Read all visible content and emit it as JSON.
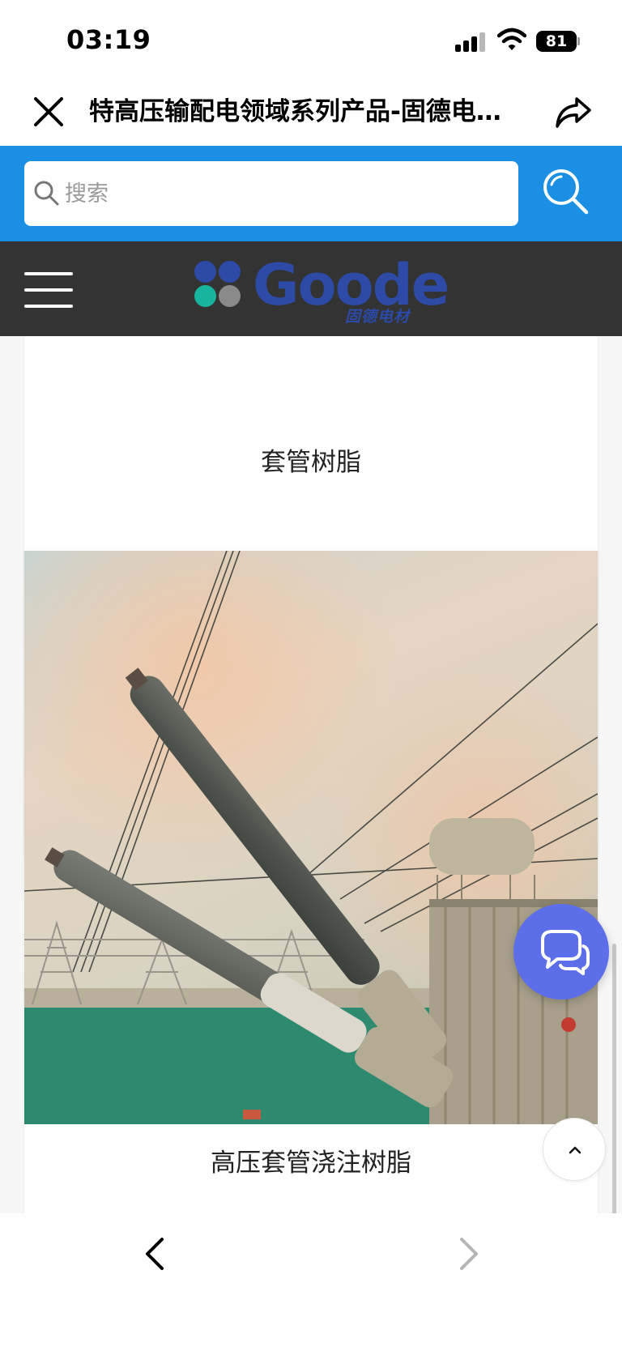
{
  "status_bar": {
    "time": "03:19",
    "battery_level": "81",
    "icons": [
      "signal-icon",
      "wifi-icon",
      "battery-icon"
    ]
  },
  "title_bar": {
    "title": "特高压输配电领域系列产品-固德电…",
    "icons": [
      "close-icon",
      "share-icon"
    ]
  },
  "search": {
    "placeholder": "搜索",
    "value": "",
    "accent_color": "#1a8fe3"
  },
  "header": {
    "logo_text": "Goode",
    "logo_subtitle": "固德电材",
    "background_color": "#333333",
    "brand_color": "#2c4aa6",
    "icons": [
      "menu-icon"
    ]
  },
  "products": [
    {
      "caption": "套管树脂"
    },
    {
      "caption": "高压套管浇注树脂"
    }
  ],
  "floating": {
    "chat_color": "#5d6fe8",
    "icons": [
      "chat-icon",
      "chevron-up-icon"
    ]
  },
  "bottom_nav": {
    "icons": [
      "chevron-left-icon",
      "chevron-right-icon"
    ]
  }
}
